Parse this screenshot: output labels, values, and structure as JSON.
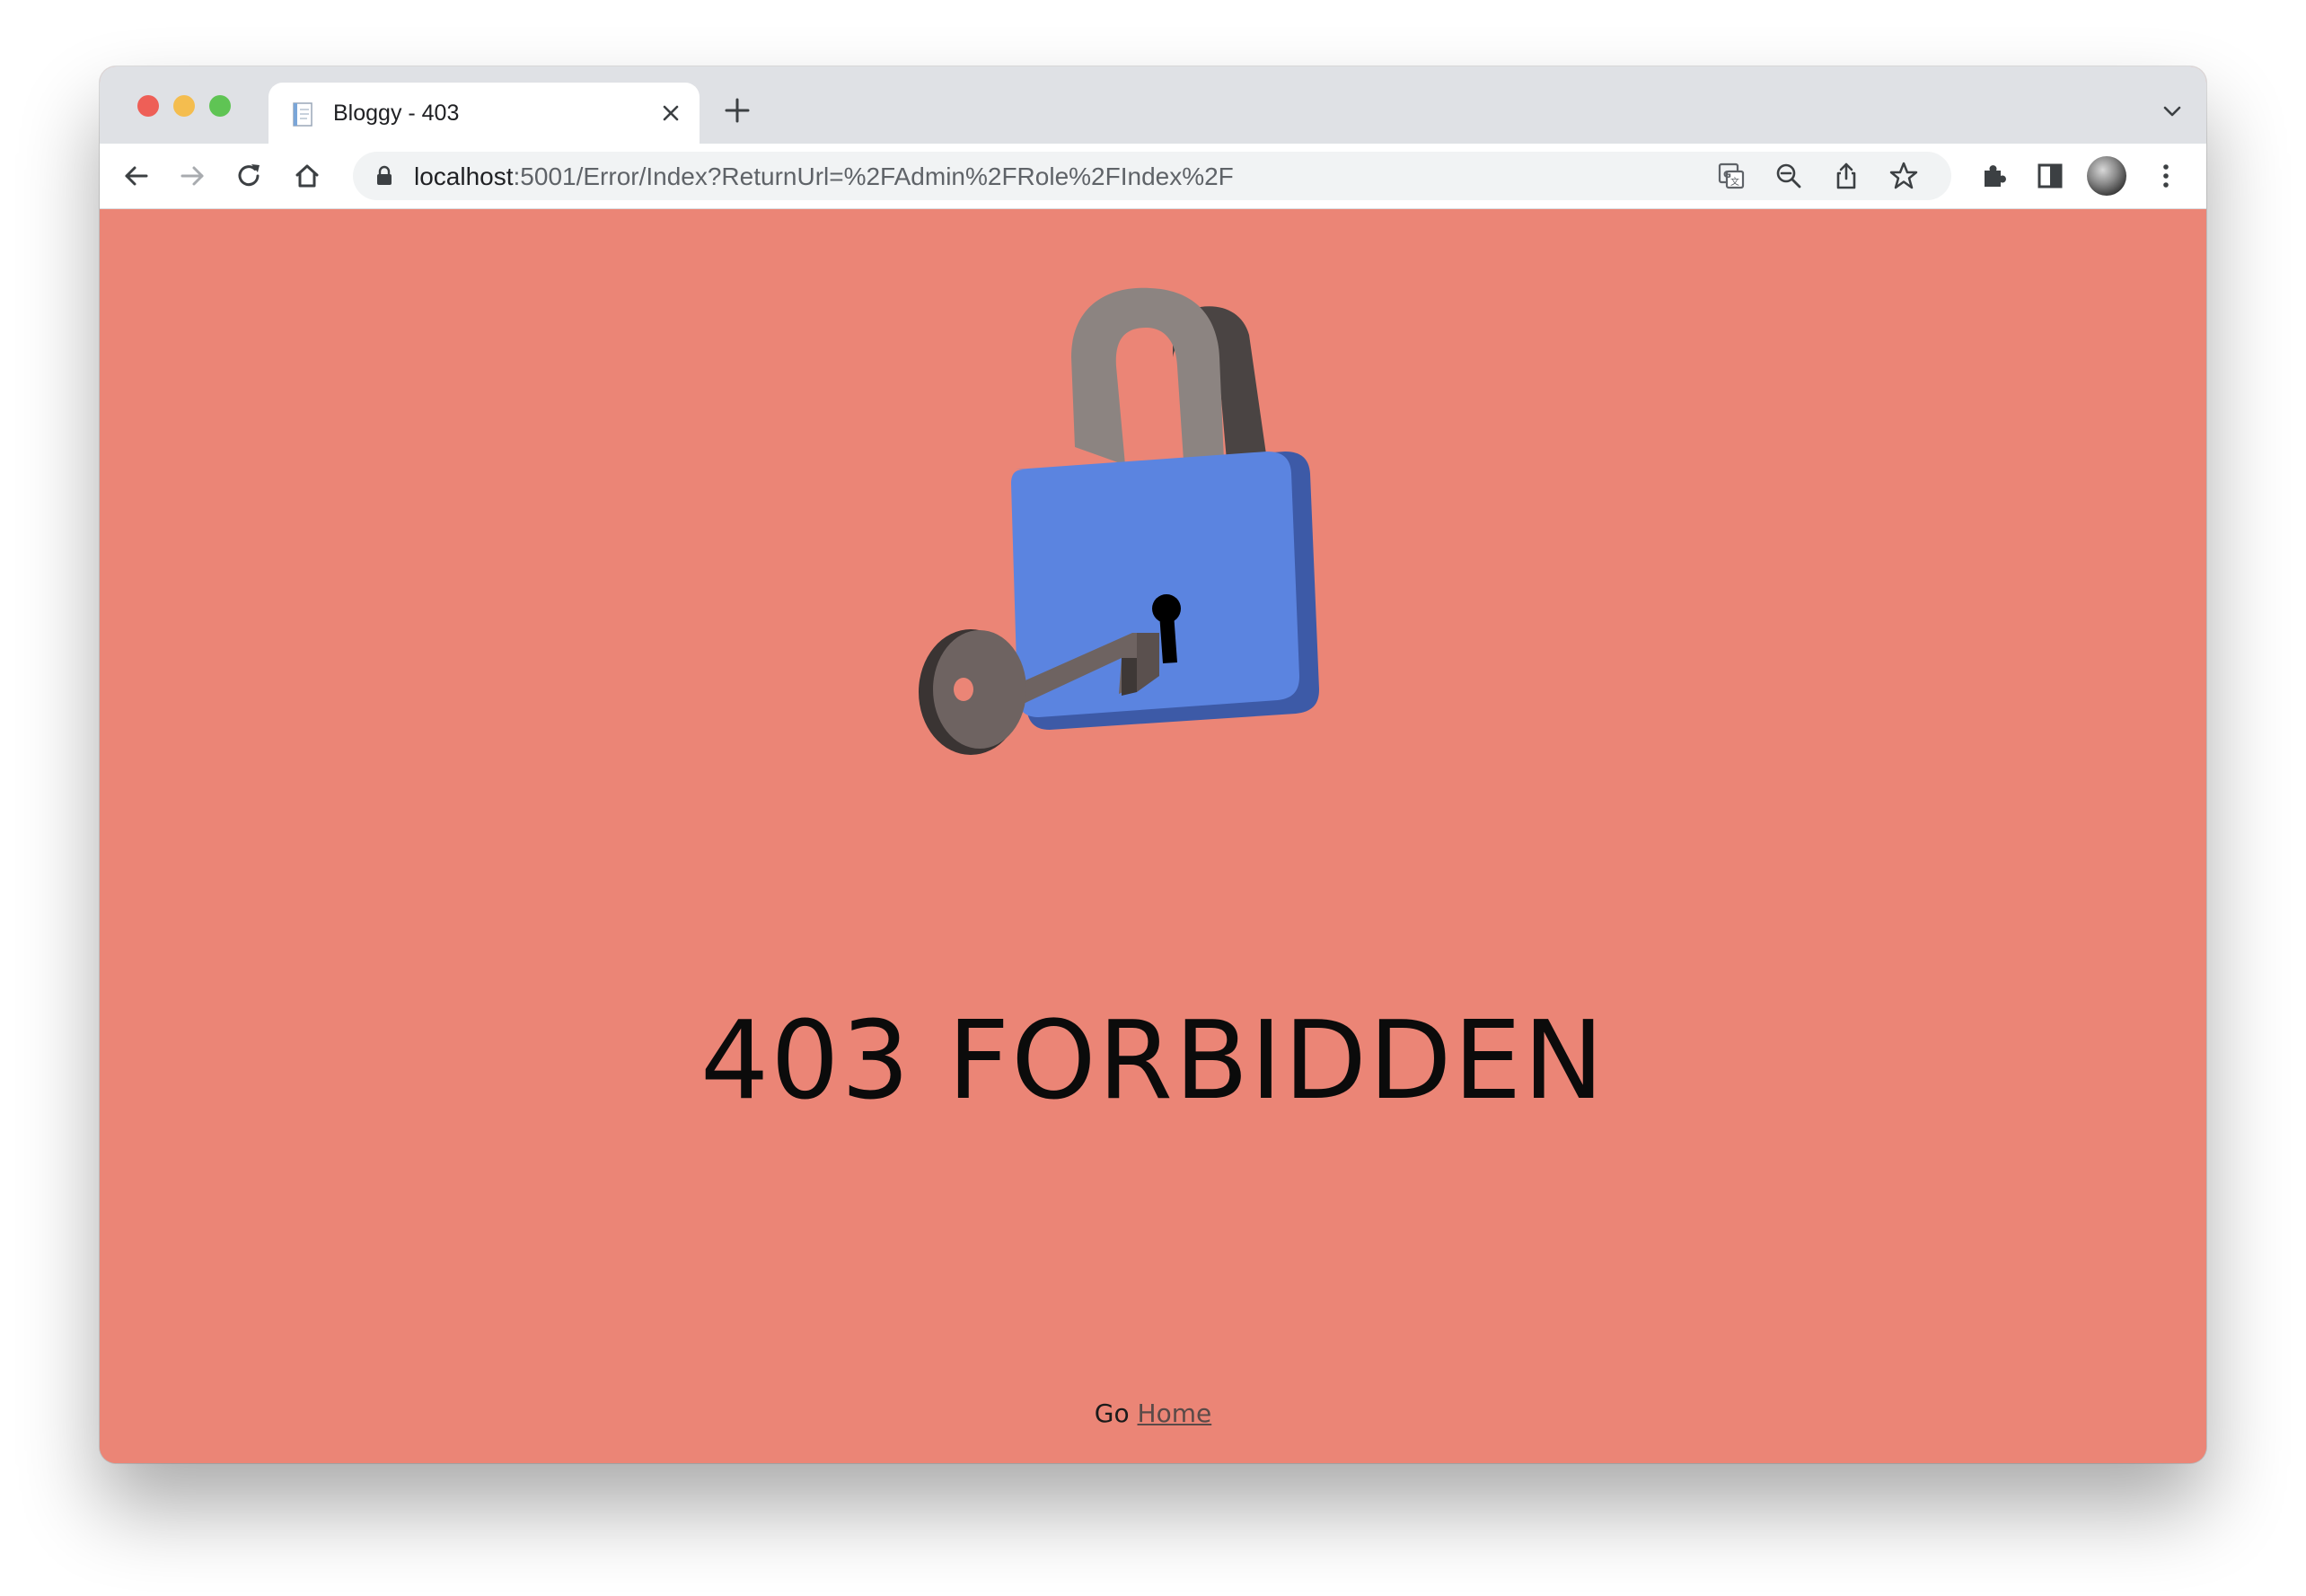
{
  "browser": {
    "tab": {
      "title": "Bloggy - 403"
    },
    "address_bar": {
      "host": "localhost",
      "path": ":5001/Error/Index?ReturnUrl=%2FAdmin%2FRole%2FIndex%2F"
    },
    "icons": {
      "back": "back-arrow-icon",
      "forward": "forward-arrow-icon",
      "reload": "reload-icon",
      "home": "home-icon",
      "translate": "translate-icon",
      "zoom": "zoom-out-icon",
      "share": "share-icon",
      "bookmark": "star-icon",
      "extensions": "puzzle-icon",
      "side_panel": "side-panel-icon",
      "menu": "kebab-menu-icon"
    }
  },
  "page": {
    "heading": "403 FORBIDDEN",
    "footer_prefix": "Go",
    "home_link": "Home",
    "colors": {
      "background": "#eb8576",
      "lock_body": "#5b84e0",
      "shackle": "#8b8480",
      "key": "#6e6361"
    }
  }
}
